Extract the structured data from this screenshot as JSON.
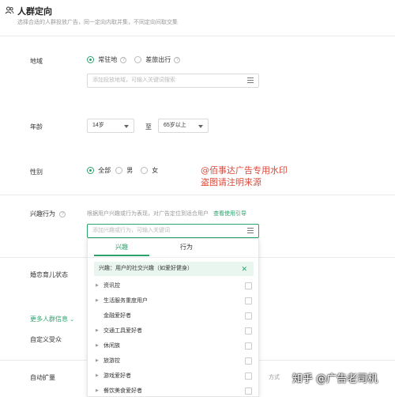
{
  "header": {
    "title": "人群定向",
    "subtitle": "选择合适的人群投放广告，同一定向内取并集，不同定向间取交集"
  },
  "region": {
    "label": "地域",
    "option_resident": "常驻地",
    "option_travel": "差旅出行",
    "search_placeholder": "添加投放地域，可输入关键词搜索"
  },
  "age": {
    "label": "年龄",
    "from": "14岁",
    "to_label": "至",
    "to": "65岁以上"
  },
  "gender": {
    "label": "性别",
    "option_all": "全部",
    "option_male": "男",
    "option_female": "女"
  },
  "interest": {
    "label": "兴趣行为",
    "hint": "根据用户兴趣或行为表现，对广告定位到适合用户",
    "guide_link": "查看使用引导",
    "search_placeholder": "添加兴趣或行为，可输入关键词"
  },
  "marital": {
    "label": "婚恋育儿状态"
  },
  "more": {
    "label": "更多人群信息"
  },
  "custom": {
    "label": "自定义受众"
  },
  "auto_expand": {
    "label": "自动扩量",
    "tail": "方式"
  },
  "dropdown": {
    "tabs": [
      "兴趣",
      "行为"
    ],
    "selected_tag": "兴趣：用户的社交兴趣（如爱好健身）",
    "items": [
      {
        "label": "资讯控",
        "has_children": true
      },
      {
        "label": "生活服务重度用户",
        "has_children": true
      },
      {
        "label": "金融爱好者",
        "has_children": false
      },
      {
        "label": "交通工具爱好者",
        "has_children": true
      },
      {
        "label": "休闲族",
        "has_children": true
      },
      {
        "label": "旅游控",
        "has_children": true
      },
      {
        "label": "游戏爱好者",
        "has_children": true
      },
      {
        "label": "餐饮美食爱好者",
        "has_children": true
      }
    ]
  },
  "watermark": {
    "line1": "@佰事达广告专用水印",
    "line2": "盗图请注明来源",
    "corner": "知乎 @广告老司机"
  },
  "colors": {
    "accent": "#2aa36b",
    "watermark": "#e0483a"
  }
}
